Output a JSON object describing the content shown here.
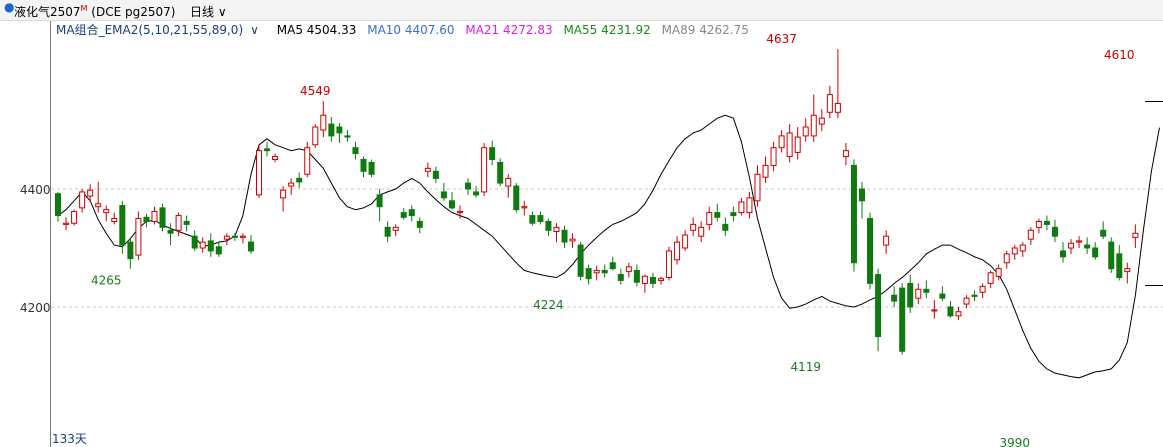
{
  "header": {
    "instrument": "液化气2507",
    "instrument_mark": "M",
    "contract": "(DCE pg2507)",
    "period": "日线",
    "period_icon": "chevron-down-icon"
  },
  "legend": {
    "indicator": "MA组合_EMA2(5,10,21,55,89,0)",
    "items": [
      {
        "label": "MA5 4504.33",
        "color": "#000000"
      },
      {
        "label": "MA10 4407.60",
        "color": "#3a6fd8"
      },
      {
        "label": "MA21 4272.83",
        "color": "#e020e0"
      },
      {
        "label": "MA55 4231.92",
        "color": "#1a8a1a"
      },
      {
        "label": "MA89 4262.75",
        "color": "#888888"
      }
    ]
  },
  "footer": {
    "day_count": "133天"
  },
  "chart_data": {
    "type": "candlestick",
    "yticks": [
      4200,
      4400
    ],
    "ylim": [
      3975,
      4670
    ],
    "grid": "dashed horizontal",
    "colors": {
      "up": "#d00000",
      "down": "#0f7a0f",
      "high_label": "#c80000",
      "low_label": "#1e7a1e"
    },
    "annotations": [
      {
        "text": "4265",
        "index": 6,
        "value": 4265,
        "kind": "low"
      },
      {
        "text": "4549",
        "index": 32,
        "value": 4549,
        "kind": "high"
      },
      {
        "text": "4224",
        "index": 61,
        "value": 4224,
        "kind": "low"
      },
      {
        "text": "4637",
        "index": 90,
        "value": 4637,
        "kind": "high"
      },
      {
        "text": "4119",
        "index": 93,
        "value": 4119,
        "kind": "low"
      },
      {
        "text": "3990",
        "index": 119,
        "value": 3990,
        "kind": "low"
      },
      {
        "text": "4610",
        "index": 132,
        "value": 4610,
        "kind": "high"
      }
    ],
    "candles": [
      [
        4392,
        4395,
        4345,
        4355
      ],
      [
        4340,
        4352,
        4330,
        4342
      ],
      [
        4342,
        4365,
        4338,
        4362
      ],
      [
        4368,
        4400,
        4360,
        4395
      ],
      [
        4388,
        4408,
        4378,
        4398
      ],
      [
        4370,
        4412,
        4360,
        4375
      ],
      [
        4360,
        4372,
        4345,
        4365
      ],
      [
        4345,
        4360,
        4340,
        4350
      ],
      [
        4372,
        4380,
        4290,
        4305
      ],
      [
        4310,
        4318,
        4265,
        4282
      ],
      [
        4288,
        4362,
        4280,
        4350
      ],
      [
        4352,
        4358,
        4335,
        4345
      ],
      [
        4345,
        4370,
        4340,
        4362
      ],
      [
        4368,
        4375,
        4328,
        4335
      ],
      [
        4330,
        4342,
        4305,
        4325
      ],
      [
        4330,
        4360,
        4320,
        4355
      ],
      [
        4345,
        4355,
        4328,
        4340
      ],
      [
        4320,
        4330,
        4295,
        4300
      ],
      [
        4300,
        4318,
        4292,
        4310
      ],
      [
        4312,
        4325,
        4285,
        4295
      ],
      [
        4302,
        4310,
        4285,
        4290
      ],
      [
        4315,
        4325,
        4305,
        4320
      ],
      [
        4320,
        4325,
        4312,
        4318
      ],
      [
        4318,
        4325,
        4308,
        4320
      ],
      [
        4310,
        4322,
        4290,
        4295
      ],
      [
        4390,
        4475,
        4385,
        4465
      ],
      [
        4468,
        4480,
        4455,
        4465
      ],
      [
        4450,
        4460,
        4445,
        4455
      ],
      [
        4385,
        4405,
        4362,
        4398
      ],
      [
        4405,
        4418,
        4390,
        4410
      ],
      [
        4418,
        4428,
        4402,
        4412
      ],
      [
        4425,
        4480,
        4420,
        4470
      ],
      [
        4475,
        4510,
        4470,
        4505
      ],
      [
        4500,
        4549,
        4488,
        4525
      ],
      [
        4510,
        4522,
        4480,
        4490
      ],
      [
        4505,
        4512,
        4478,
        4495
      ],
      [
        4490,
        4500,
        4480,
        4488
      ],
      [
        4470,
        4480,
        4450,
        4460
      ],
      [
        4450,
        4455,
        4420,
        4430
      ],
      [
        4445,
        4450,
        4420,
        4425
      ],
      [
        4390,
        4400,
        4345,
        4370
      ],
      [
        4335,
        4345,
        4310,
        4320
      ],
      [
        4330,
        4340,
        4320,
        4335
      ],
      [
        4360,
        4368,
        4348,
        4352
      ],
      [
        4365,
        4372,
        4345,
        4355
      ],
      [
        4345,
        4352,
        4325,
        4335
      ],
      [
        4430,
        4445,
        4420,
        4435
      ],
      [
        4430,
        4438,
        4410,
        4418
      ],
      [
        4395,
        4410,
        4380,
        4385
      ],
      [
        4380,
        4395,
        4365,
        4368
      ],
      [
        4360,
        4372,
        4350,
        4362
      ],
      [
        4410,
        4418,
        4390,
        4400
      ],
      [
        4395,
        4405,
        4385,
        4390
      ],
      [
        4395,
        4478,
        4388,
        4470
      ],
      [
        4470,
        4482,
        4440,
        4450
      ],
      [
        4445,
        4452,
        4405,
        4410
      ],
      [
        4405,
        4425,
        4385,
        4418
      ],
      [
        4405,
        4410,
        4360,
        4365
      ],
      [
        4368,
        4380,
        4355,
        4370
      ],
      [
        4355,
        4362,
        4338,
        4342
      ],
      [
        4355,
        4362,
        4340,
        4345
      ],
      [
        4345,
        4350,
        4320,
        4330
      ],
      [
        4328,
        4342,
        4310,
        4335
      ],
      [
        4330,
        4338,
        4300,
        4310
      ],
      [
        4312,
        4325,
        4300,
        4315
      ],
      [
        4305,
        4310,
        4245,
        4252
      ],
      [
        4265,
        4272,
        4238,
        4248
      ],
      [
        4258,
        4270,
        4245,
        4262
      ],
      [
        4262,
        4272,
        4250,
        4258
      ],
      [
        4275,
        4285,
        4262,
        4265
      ],
      [
        4255,
        4265,
        4238,
        4245
      ],
      [
        4260,
        4275,
        4250,
        4268
      ],
      [
        4262,
        4272,
        4235,
        4242
      ],
      [
        4240,
        4255,
        4224,
        4252
      ],
      [
        4250,
        4258,
        4232,
        4240
      ],
      [
        4245,
        4252,
        4238,
        4248
      ],
      [
        4250,
        4302,
        4245,
        4295
      ],
      [
        4280,
        4320,
        4272,
        4310
      ],
      [
        4300,
        4330,
        4295,
        4322
      ],
      [
        4330,
        4352,
        4320,
        4340
      ],
      [
        4320,
        4345,
        4310,
        4335
      ],
      [
        4340,
        4370,
        4330,
        4360
      ],
      [
        4360,
        4375,
        4345,
        4352
      ],
      [
        4340,
        4352,
        4320,
        4330
      ],
      [
        4360,
        4370,
        4345,
        4355
      ],
      [
        4360,
        4385,
        4355,
        4378
      ],
      [
        4360,
        4395,
        4350,
        4385
      ],
      [
        4380,
        4440,
        4370,
        4425
      ],
      [
        4420,
        4455,
        4410,
        4440
      ],
      [
        4440,
        4480,
        4430,
        4470
      ],
      [
        4470,
        4500,
        4462,
        4490
      ],
      [
        4455,
        4510,
        4445,
        4495
      ],
      [
        4462,
        4505,
        4450,
        4488
      ],
      [
        4490,
        4520,
        4480,
        4505
      ],
      [
        4490,
        4560,
        4480,
        4525
      ],
      [
        4510,
        4535,
        4498,
        4520
      ],
      [
        4530,
        4575,
        4520,
        4560
      ],
      [
        4530,
        4637,
        4520,
        4545
      ],
      [
        4455,
        4478,
        4440,
        4465
      ],
      [
        4440,
        4450,
        4260,
        4275
      ],
      [
        4400,
        4412,
        4350,
        4380
      ],
      [
        4350,
        4360,
        4230,
        4240
      ],
      [
        4255,
        4265,
        4125,
        4150
      ],
      [
        4305,
        4330,
        4290,
        4320
      ],
      [
        4220,
        4235,
        4200,
        4210
      ],
      [
        4232,
        4240,
        4119,
        4125
      ],
      [
        4240,
        4255,
        4190,
        4200
      ],
      [
        4215,
        4240,
        4205,
        4230
      ],
      [
        4230,
        4245,
        4215,
        4225
      ],
      [
        4195,
        4212,
        4180,
        4195
      ],
      [
        4222,
        4235,
        4210,
        4215
      ],
      [
        4200,
        4210,
        4182,
        4185
      ],
      [
        4185,
        4200,
        4178,
        4192
      ],
      [
        4205,
        4220,
        4198,
        4215
      ],
      [
        4220,
        4228,
        4210,
        4218
      ],
      [
        4225,
        4240,
        4215,
        4235
      ],
      [
        4240,
        4262,
        4232,
        4258
      ],
      [
        4252,
        4272,
        4245,
        4265
      ],
      [
        4275,
        4295,
        4265,
        4290
      ],
      [
        4290,
        4305,
        4280,
        4300
      ],
      [
        4295,
        4310,
        4285,
        4305
      ],
      [
        4315,
        4335,
        4305,
        4330
      ],
      [
        4335,
        4350,
        4325,
        4345
      ],
      [
        4345,
        4355,
        4330,
        4340
      ],
      [
        4335,
        4348,
        4310,
        4320
      ],
      [
        4295,
        4310,
        4275,
        4285
      ],
      [
        4300,
        4315,
        4290,
        4308
      ],
      [
        4310,
        4320,
        4300,
        4312
      ],
      [
        4305,
        4318,
        4290,
        4300
      ],
      [
        4300,
        4310,
        4280,
        4285
      ],
      [
        4330,
        4345,
        4315,
        4320
      ],
      [
        4310,
        4318,
        4258,
        4265
      ],
      [
        4290,
        4305,
        4245,
        4250
      ],
      [
        4260,
        4275,
        4240,
        4265
      ],
      [
        4318,
        4340,
        4300,
        4325
      ]
    ],
    "series": [
      {
        "name": "MA5",
        "color": "#000000",
        "values": [
          4355,
          4365,
          4380,
          4395,
          4380,
          4348,
          4325,
          4305,
          4302,
          4316,
          4333,
          4345,
          4347,
          4339,
          4333,
          4328,
          4323,
          4318,
          4303,
          4305,
          4310,
          4312,
          4320,
          4355,
          4425,
          4475,
          4485,
          4475,
          4470,
          4465,
          4468,
          4465,
          4450,
          4435,
          4410,
          4385,
          4370,
          4365,
          4368,
          4375,
          4390,
          4395,
          4400,
          4410,
          4418,
          4410,
          4395,
          4382,
          4370,
          4360,
          4355,
          4350,
          4340,
          4330,
          4320,
          4305,
          4290,
          4275,
          4262,
          4258,
          4255,
          4252,
          4250,
          4258,
          4272,
          4290,
          4305,
          4318,
          4330,
          4340,
          4345,
          4352,
          4360,
          4375,
          4398,
          4425,
          4448,
          4470,
          4485,
          4495,
          4500,
          4510,
          4520,
          4525,
          4520,
          4480,
          4420,
          4350,
          4300,
          4250,
          4215,
          4198,
          4200,
          4205,
          4212,
          4218,
          4210,
          4206,
          4202,
          4200,
          4205,
          4212,
          4218,
          4228,
          4240,
          4250,
          4262,
          4275,
          4290,
          4298,
          4305,
          4305,
          4298,
          4292,
          4285,
          4280,
          4270,
          4255,
          4230,
          4195,
          4160,
          4130,
          4108,
          4095,
          4088,
          4085,
          4082,
          4080,
          4085,
          4090,
          4092,
          4095,
          4110,
          4140,
          4220,
          4330,
          4430,
          4504
        ]
      }
    ]
  }
}
